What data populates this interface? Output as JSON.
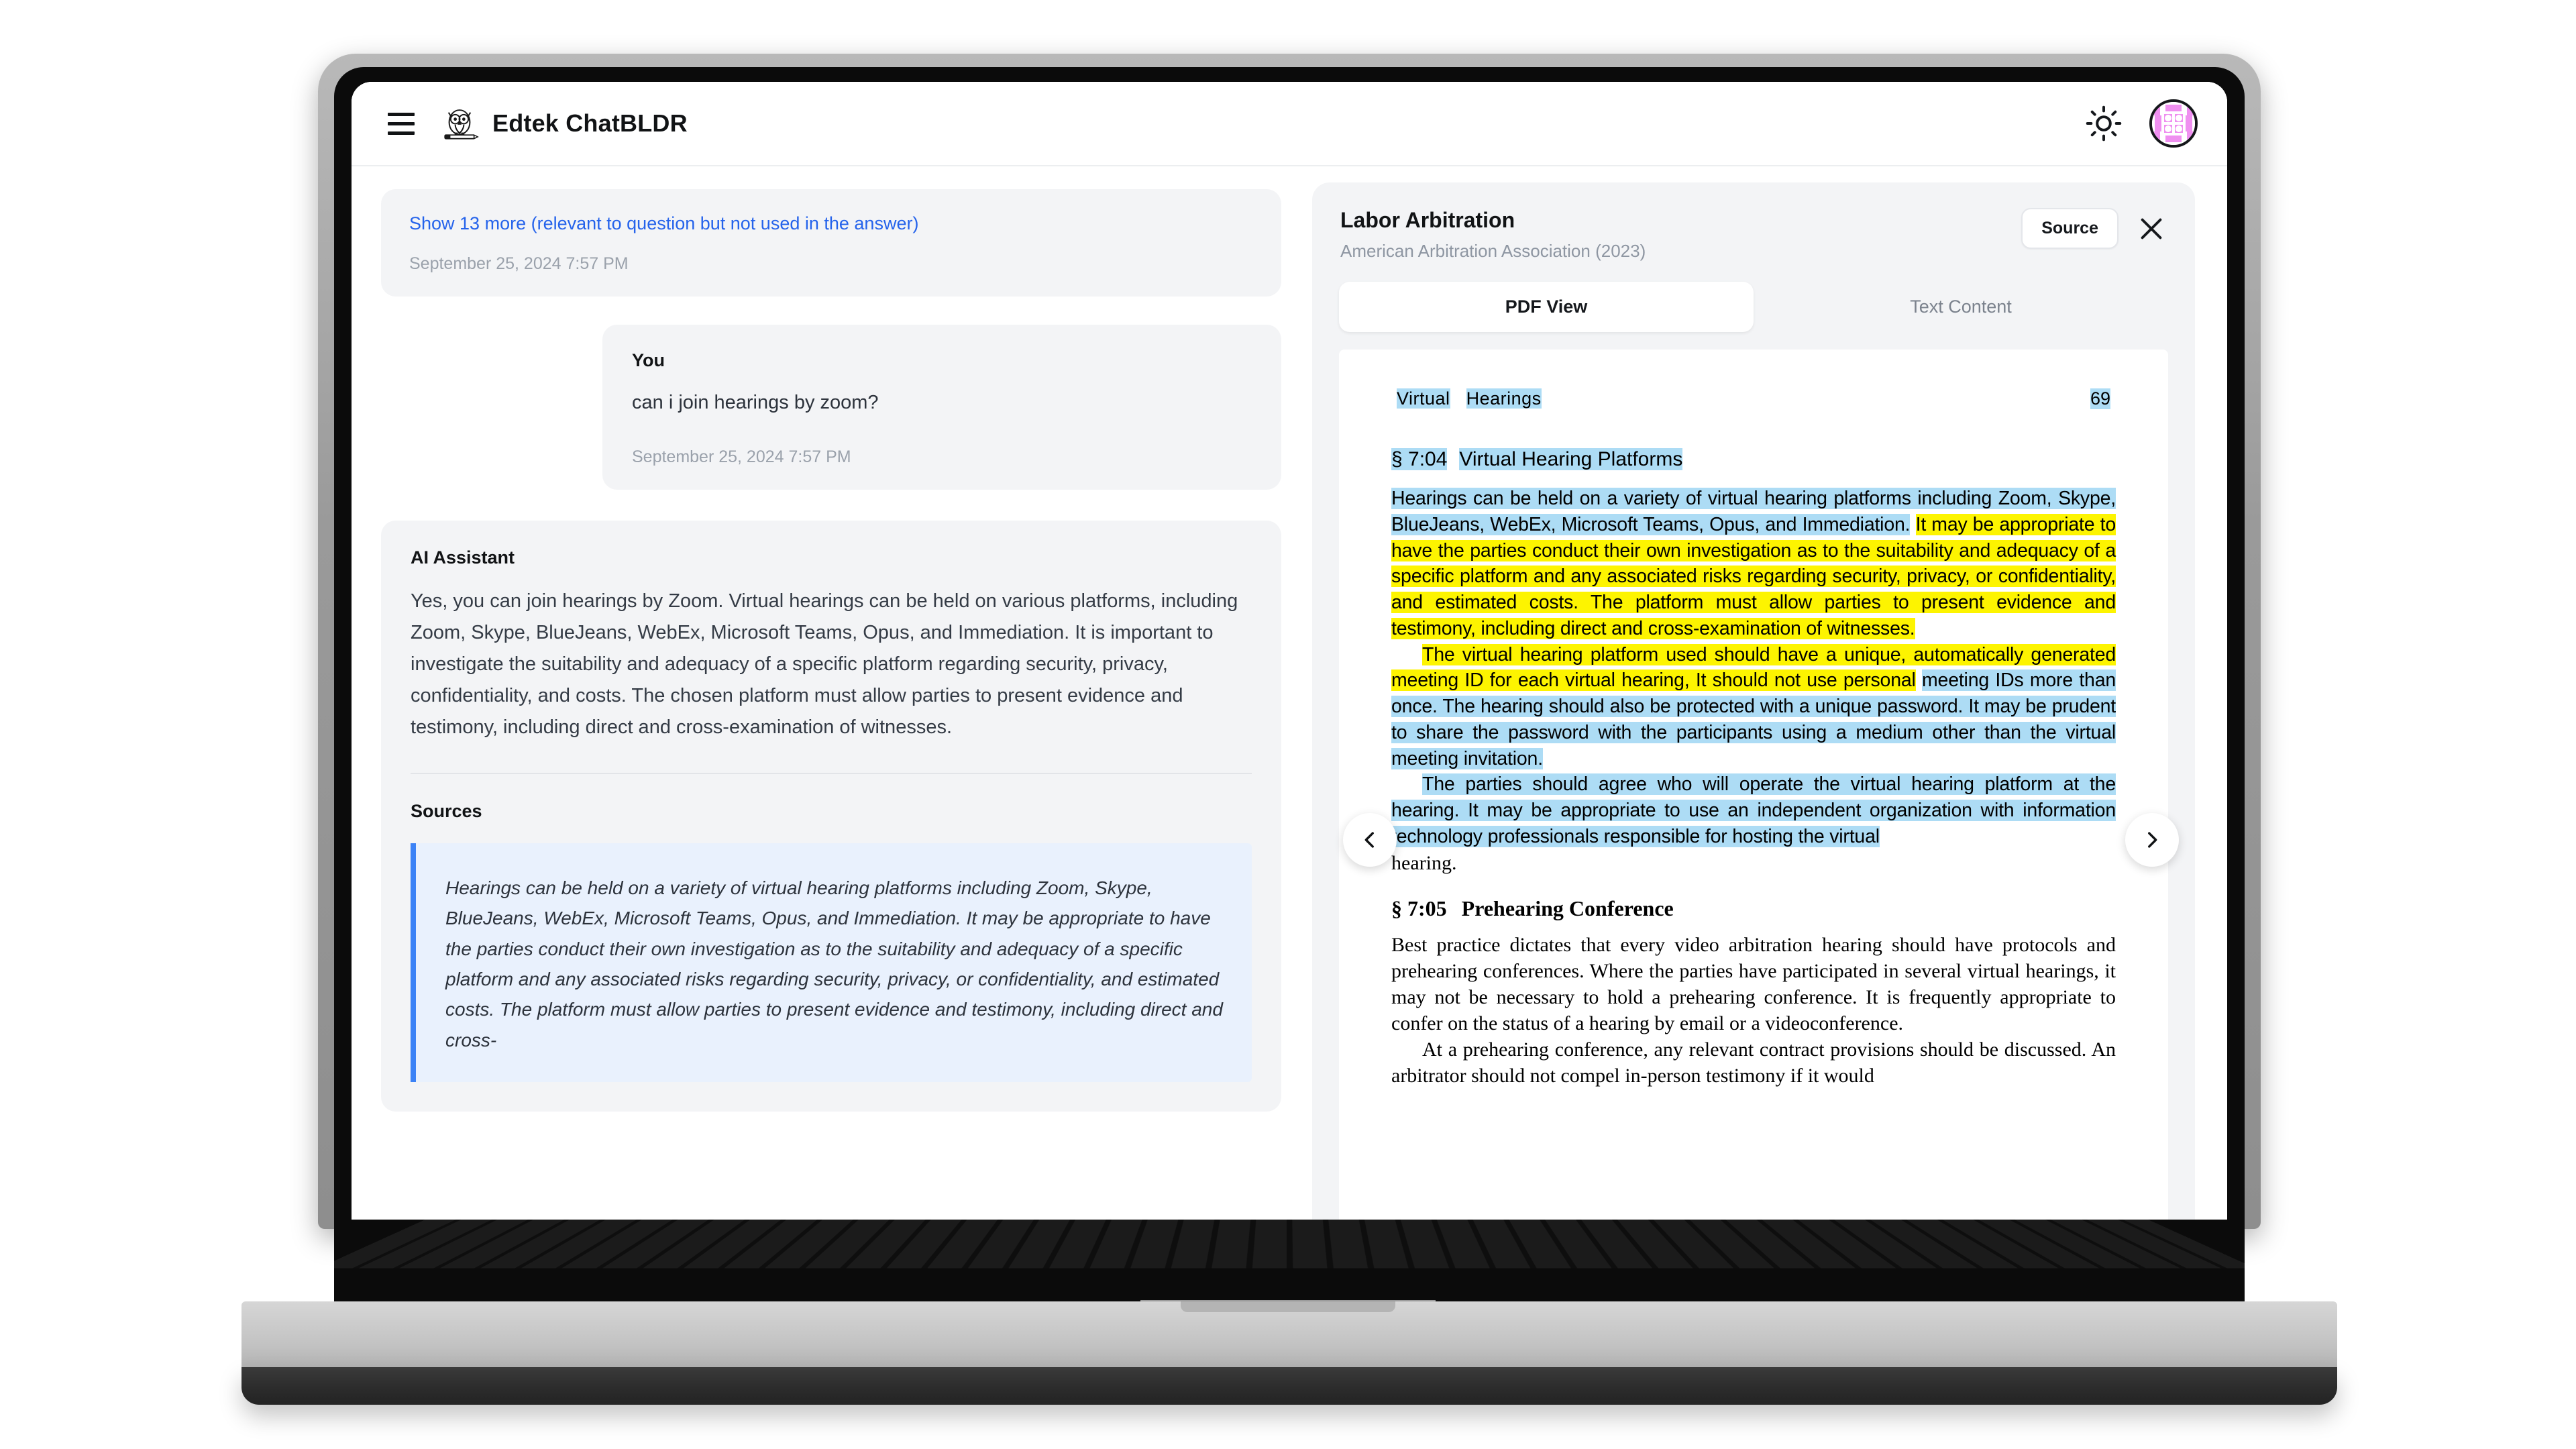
{
  "app": {
    "brand_title": "Edtek ChatBLDR",
    "icons": {
      "hamburger": "hamburger-menu-icon",
      "logo": "owl-logo-icon",
      "theme": "sun-icon",
      "avatar": "user-avatar"
    }
  },
  "chat": {
    "show_more_link": "Show 13 more (relevant to question but not used in the answer)",
    "show_more_timestamp": "September 25, 2024 7:57 PM",
    "user_message": {
      "role": "You",
      "text": "can i join hearings by zoom?",
      "timestamp": "September 25, 2024 7:57 PM"
    },
    "assistant_message": {
      "role": "AI Assistant",
      "text": "Yes, you can join hearings by Zoom. Virtual hearings can be held on various platforms, including Zoom, Skype, BlueJeans, WebEx, Microsoft Teams, Opus, and Immediation. It is important to investigate the suitability and adequacy of a specific platform regarding security, privacy, confidentiality, and costs. The chosen platform must allow parties to present evidence and testimony, including direct and cross-examination of witnesses."
    },
    "sources_heading": "Sources",
    "source_quote": "Hearings can be held on a variety of virtual hearing platforms including Zoom, Skype, BlueJeans, WebEx, Microsoft Teams, Opus, and Immediation. It may be appropriate to have the parties conduct their own investigation as to the suitability and adequacy of a specific platform and any associated risks regarding security, privacy, or confidentiality, and estimated costs. The platform must allow parties to present evidence and testimony, including direct and cross-"
  },
  "document_panel": {
    "title": "Labor Arbitration",
    "subtitle": "American Arbitration Association (2023)",
    "source_button": "Source",
    "close_label": "×",
    "tabs": [
      {
        "label": "PDF View",
        "active": true
      },
      {
        "label": "Text Content",
        "active": false
      }
    ],
    "pdf": {
      "running_head_part1": "Virtual",
      "running_head_part2": "Hearings",
      "page_number": "69",
      "section_704_number": "§ 7:04",
      "section_704_title": "Virtual Hearing Platforms",
      "para1_blue": "Hearings can be held on a variety of virtual hearing platforms including Zoom, Skype, BlueJeans, WebEx, Microsoft Teams, Opus, and Immediation.",
      "para1_yellow": "It may be appropriate to have the parties conduct their own investigation as to the suitability and adequacy of a specific platform and any associated risks regarding security, privacy, or confidentiality, and estimated costs.  The platform must allow parties to present evidence and testimony, including direct and cross-examination of witnesses.",
      "para2_yellow": "The virtual hearing platform used should have a unique, automatically generated meeting ID for each virtual hearing, It should not use personal",
      "para2_blue": "meeting IDs more than once.  The hearing should also be protected with a unique password.  It may be prudent to share the password with the participants using a medium other than the virtual meeting invitation.",
      "para3_blue": "The parties should agree who will operate the virtual hearing platform at the hearing.  It may be appropriate to use an independent organization with information technology professionals responsible for hosting the virtual",
      "para3_plain": "hearing.",
      "section_705_number": "§ 7:05",
      "section_705_title": "Prehearing Conference",
      "para4": "Best practice dictates that every video arbitration hearing should have protocols and prehearing conferences. Where the parties have participated in several virtual hearings, it may not be necessary to hold a prehearing conference. It is frequently appropriate to confer on the status of a hearing by email or a videoconference.",
      "para5": "At a prehearing conference, any relevant contract provisions should be discussed.  An arbitrator should not compel in-person testimony if it would",
      "prev_label": "‹",
      "next_label": "›"
    }
  },
  "colors": {
    "link_blue": "#2563eb",
    "highlight_blue": "#addcf5",
    "highlight_yellow": "#fdf400",
    "quote_border": "#3b82f6",
    "card_gray": "#f3f4f6"
  }
}
